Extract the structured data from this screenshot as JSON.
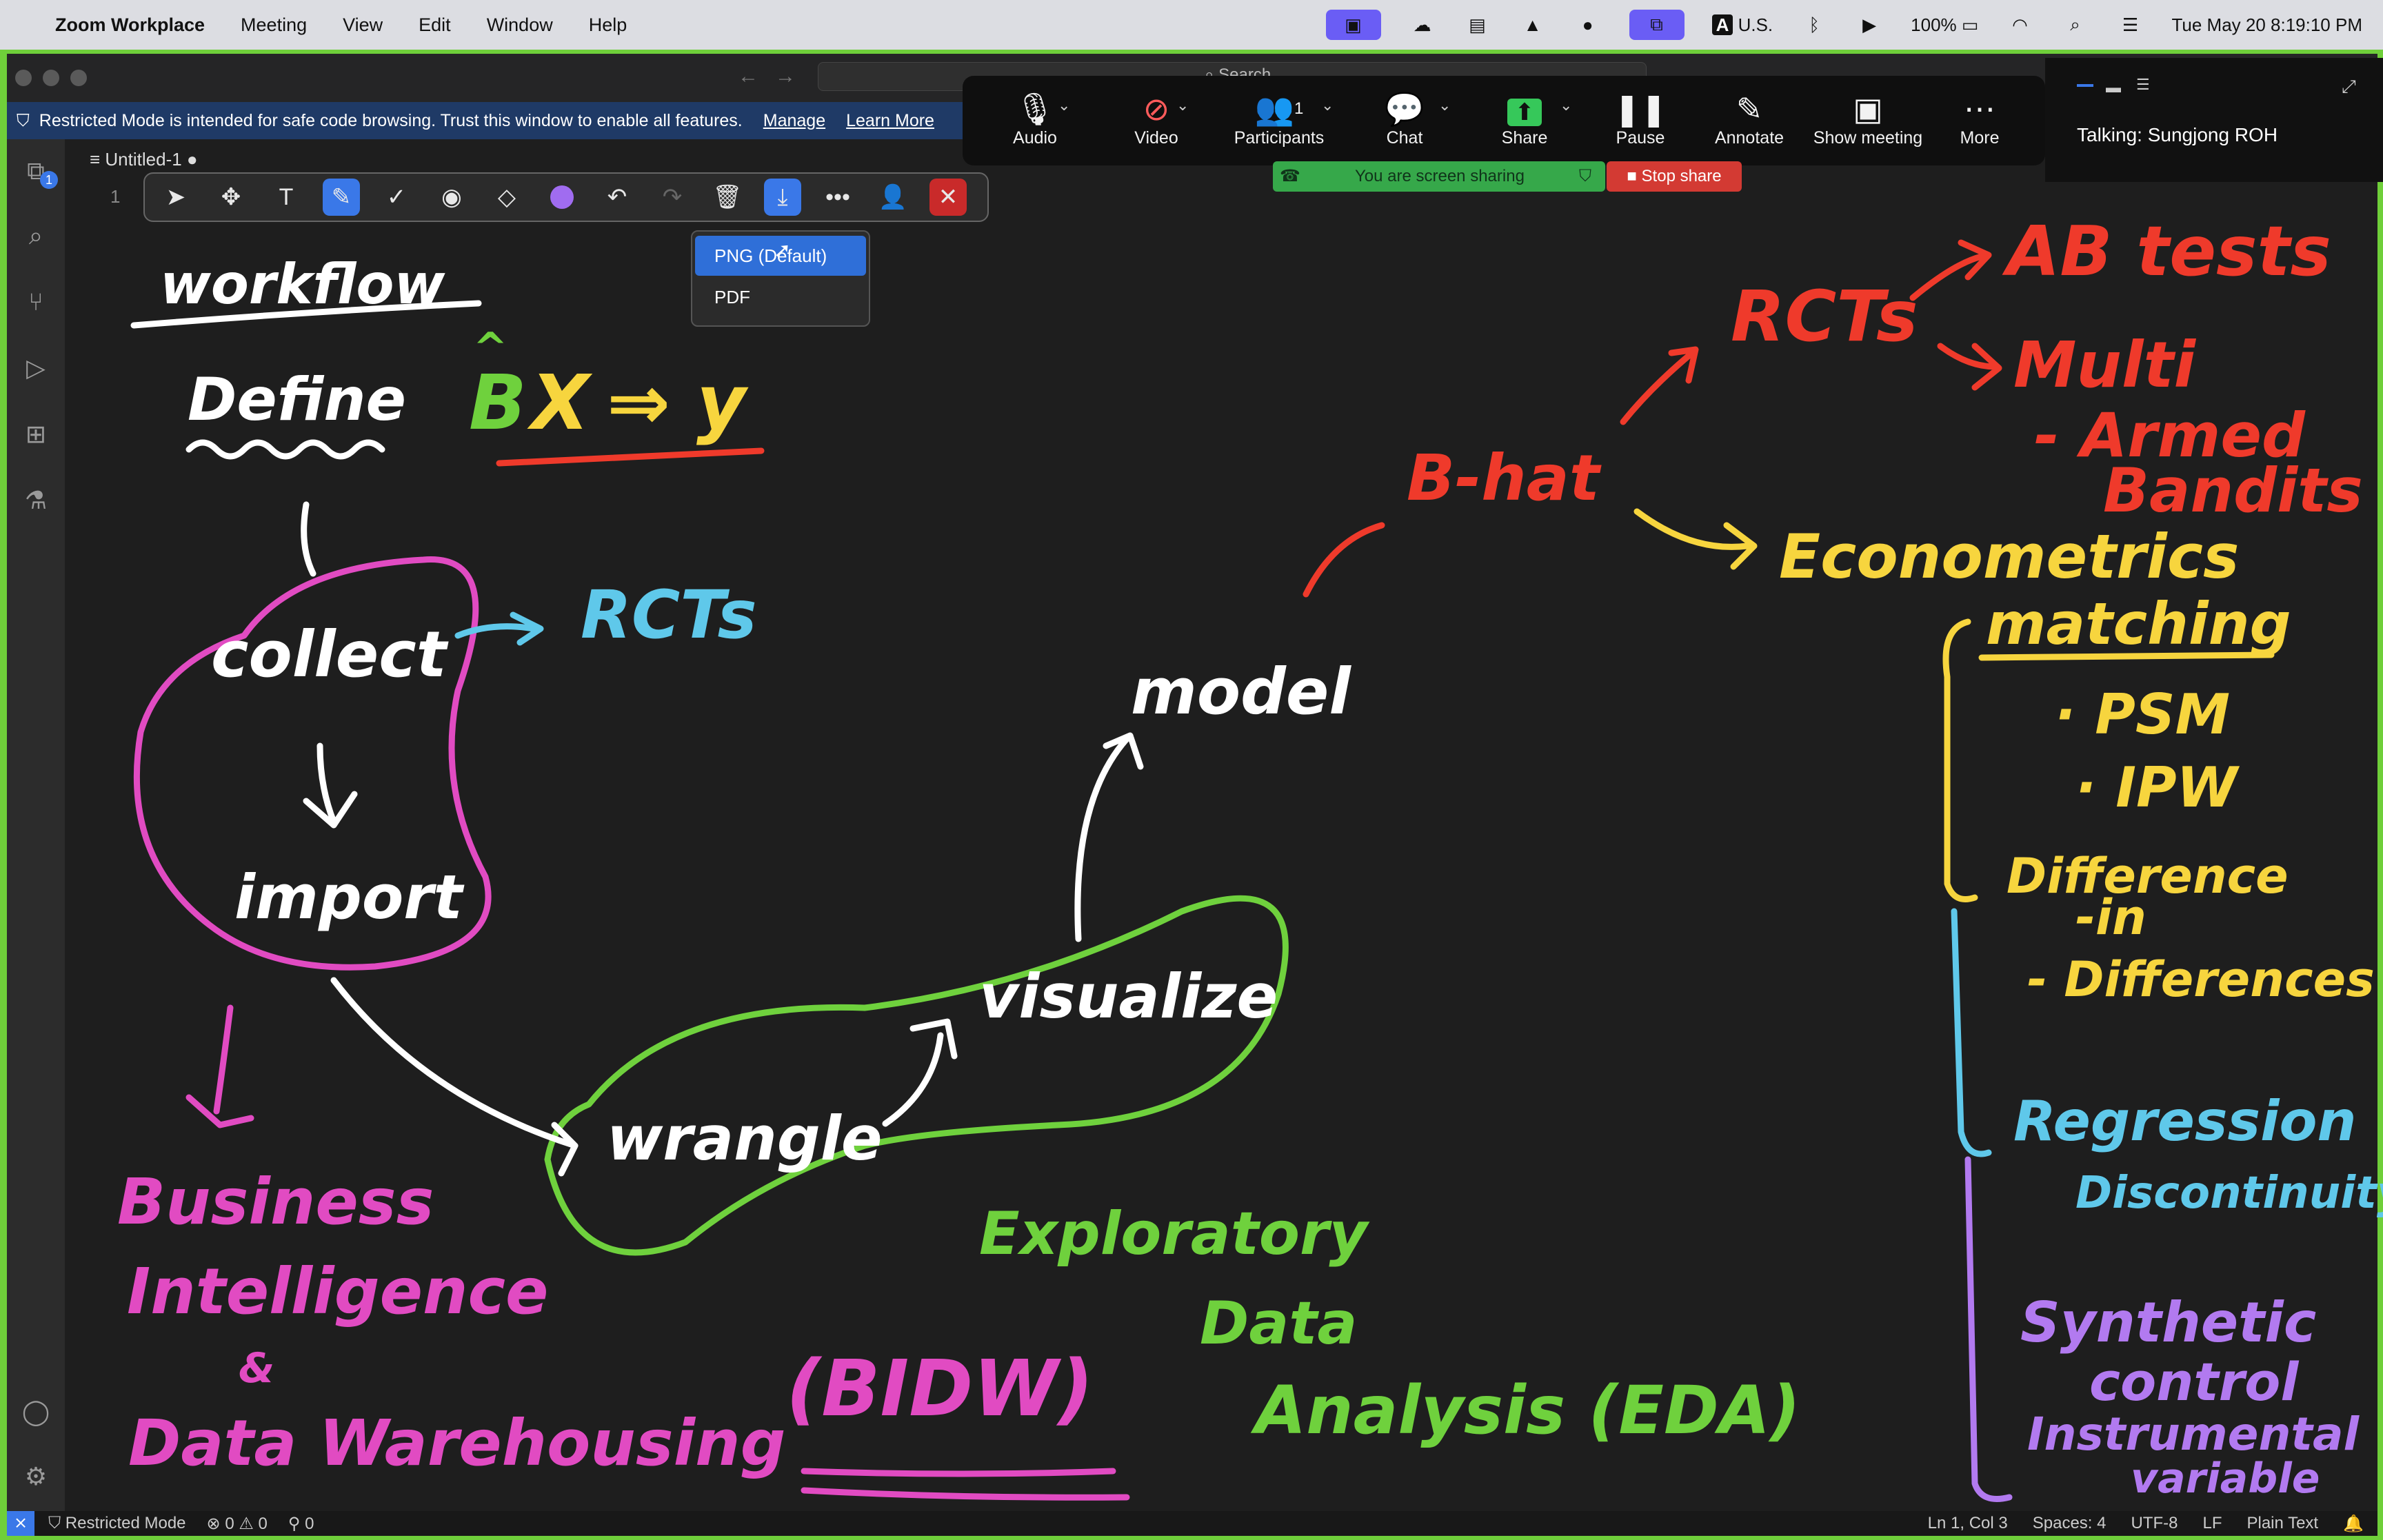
{
  "menubar": {
    "app_name": "Zoom Workplace",
    "items": [
      "Meeting",
      "View",
      "Edit",
      "Window",
      "Help"
    ],
    "input_source": "U.S.",
    "battery": "100%",
    "datetime": "Tue May 20  8:19:10 PM"
  },
  "editor": {
    "search_placeholder": "Search",
    "restricted_banner": "Restricted Mode is intended for safe code browsing. Trust this window to enable all features.",
    "manage_link": "Manage",
    "learn_more_link": "Learn More",
    "tab_name": "Untitled-1",
    "line_number": "1",
    "explorer_badge": "1"
  },
  "export_menu": {
    "options": [
      "PNG (Default)",
      "PDF"
    ]
  },
  "zoom": {
    "controls": [
      {
        "label": "Audio",
        "icon": "microphone-icon"
      },
      {
        "label": "Video",
        "icon": "video-off-icon"
      },
      {
        "label": "Participants",
        "icon": "participants-icon"
      },
      {
        "label": "Chat",
        "icon": "chat-icon"
      },
      {
        "label": "Share",
        "icon": "share-icon"
      },
      {
        "label": "Pause",
        "icon": "pause-icon"
      },
      {
        "label": "Annotate",
        "icon": "pencil-icon"
      },
      {
        "label": "Show meeting",
        "icon": "screen-icon"
      },
      {
        "label": "More",
        "icon": "ellipsis-icon"
      }
    ],
    "participant_count": "1",
    "sharing_text": "You are screen sharing",
    "stop_share": "Stop share",
    "talking": "Talking: Sungjong ROH"
  },
  "statusbar": {
    "restricted": "Restricted Mode",
    "errors": "0",
    "warnings": "0",
    "ports": "0",
    "position": "Ln 1, Col 3",
    "spaces": "Spaces: 4",
    "encoding": "UTF-8",
    "eol": "LF",
    "language": "Plain Text"
  },
  "drawing": {
    "workflow": "workflow",
    "define": "Define",
    "formula_b": "B",
    "formula_x": "X",
    "formula_arrow": "⇒",
    "formula_y": "y",
    "collect": "collect",
    "import": "import",
    "rcts_left": "RCTs",
    "business": "Business",
    "intelligence": "Intelligence",
    "amp": "&",
    "data_warehousing": "Data Warehousing",
    "bidw": "(BIDW)",
    "wrangle": "wrangle",
    "visualize": "visualize",
    "model": "model",
    "exploratory": "Exploratory",
    "data": "Data",
    "analysis": "Analysis (EDA)",
    "bhat": "B-hat",
    "rcts_right": "RCTs",
    "ab_tests": "AB tests",
    "multi": "Multi",
    "armed": "- Armed",
    "bandits": "Bandits",
    "econometrics": "Econometrics",
    "matching": "matching",
    "psm": "· PSM",
    "ipw": "· IPW",
    "difference": "Difference",
    "in": "-in",
    "differences": "- Differences",
    "regression": "Regression",
    "discontinuity": "Discontinuity",
    "synthetic": "Synthetic",
    "control": "control",
    "instrumental": "Instrumental",
    "variable": "variable"
  },
  "colors": {
    "white_ink": "#ffffff",
    "pink_ink": "#e14bc2",
    "green_ink": "#6fd13d",
    "red_ink": "#ef3a2b",
    "yellow_ink": "#f7d53e",
    "cyan_ink": "#5fc8ea",
    "purple_ink": "#b27af0",
    "accent_blue": "#3a78e8"
  }
}
